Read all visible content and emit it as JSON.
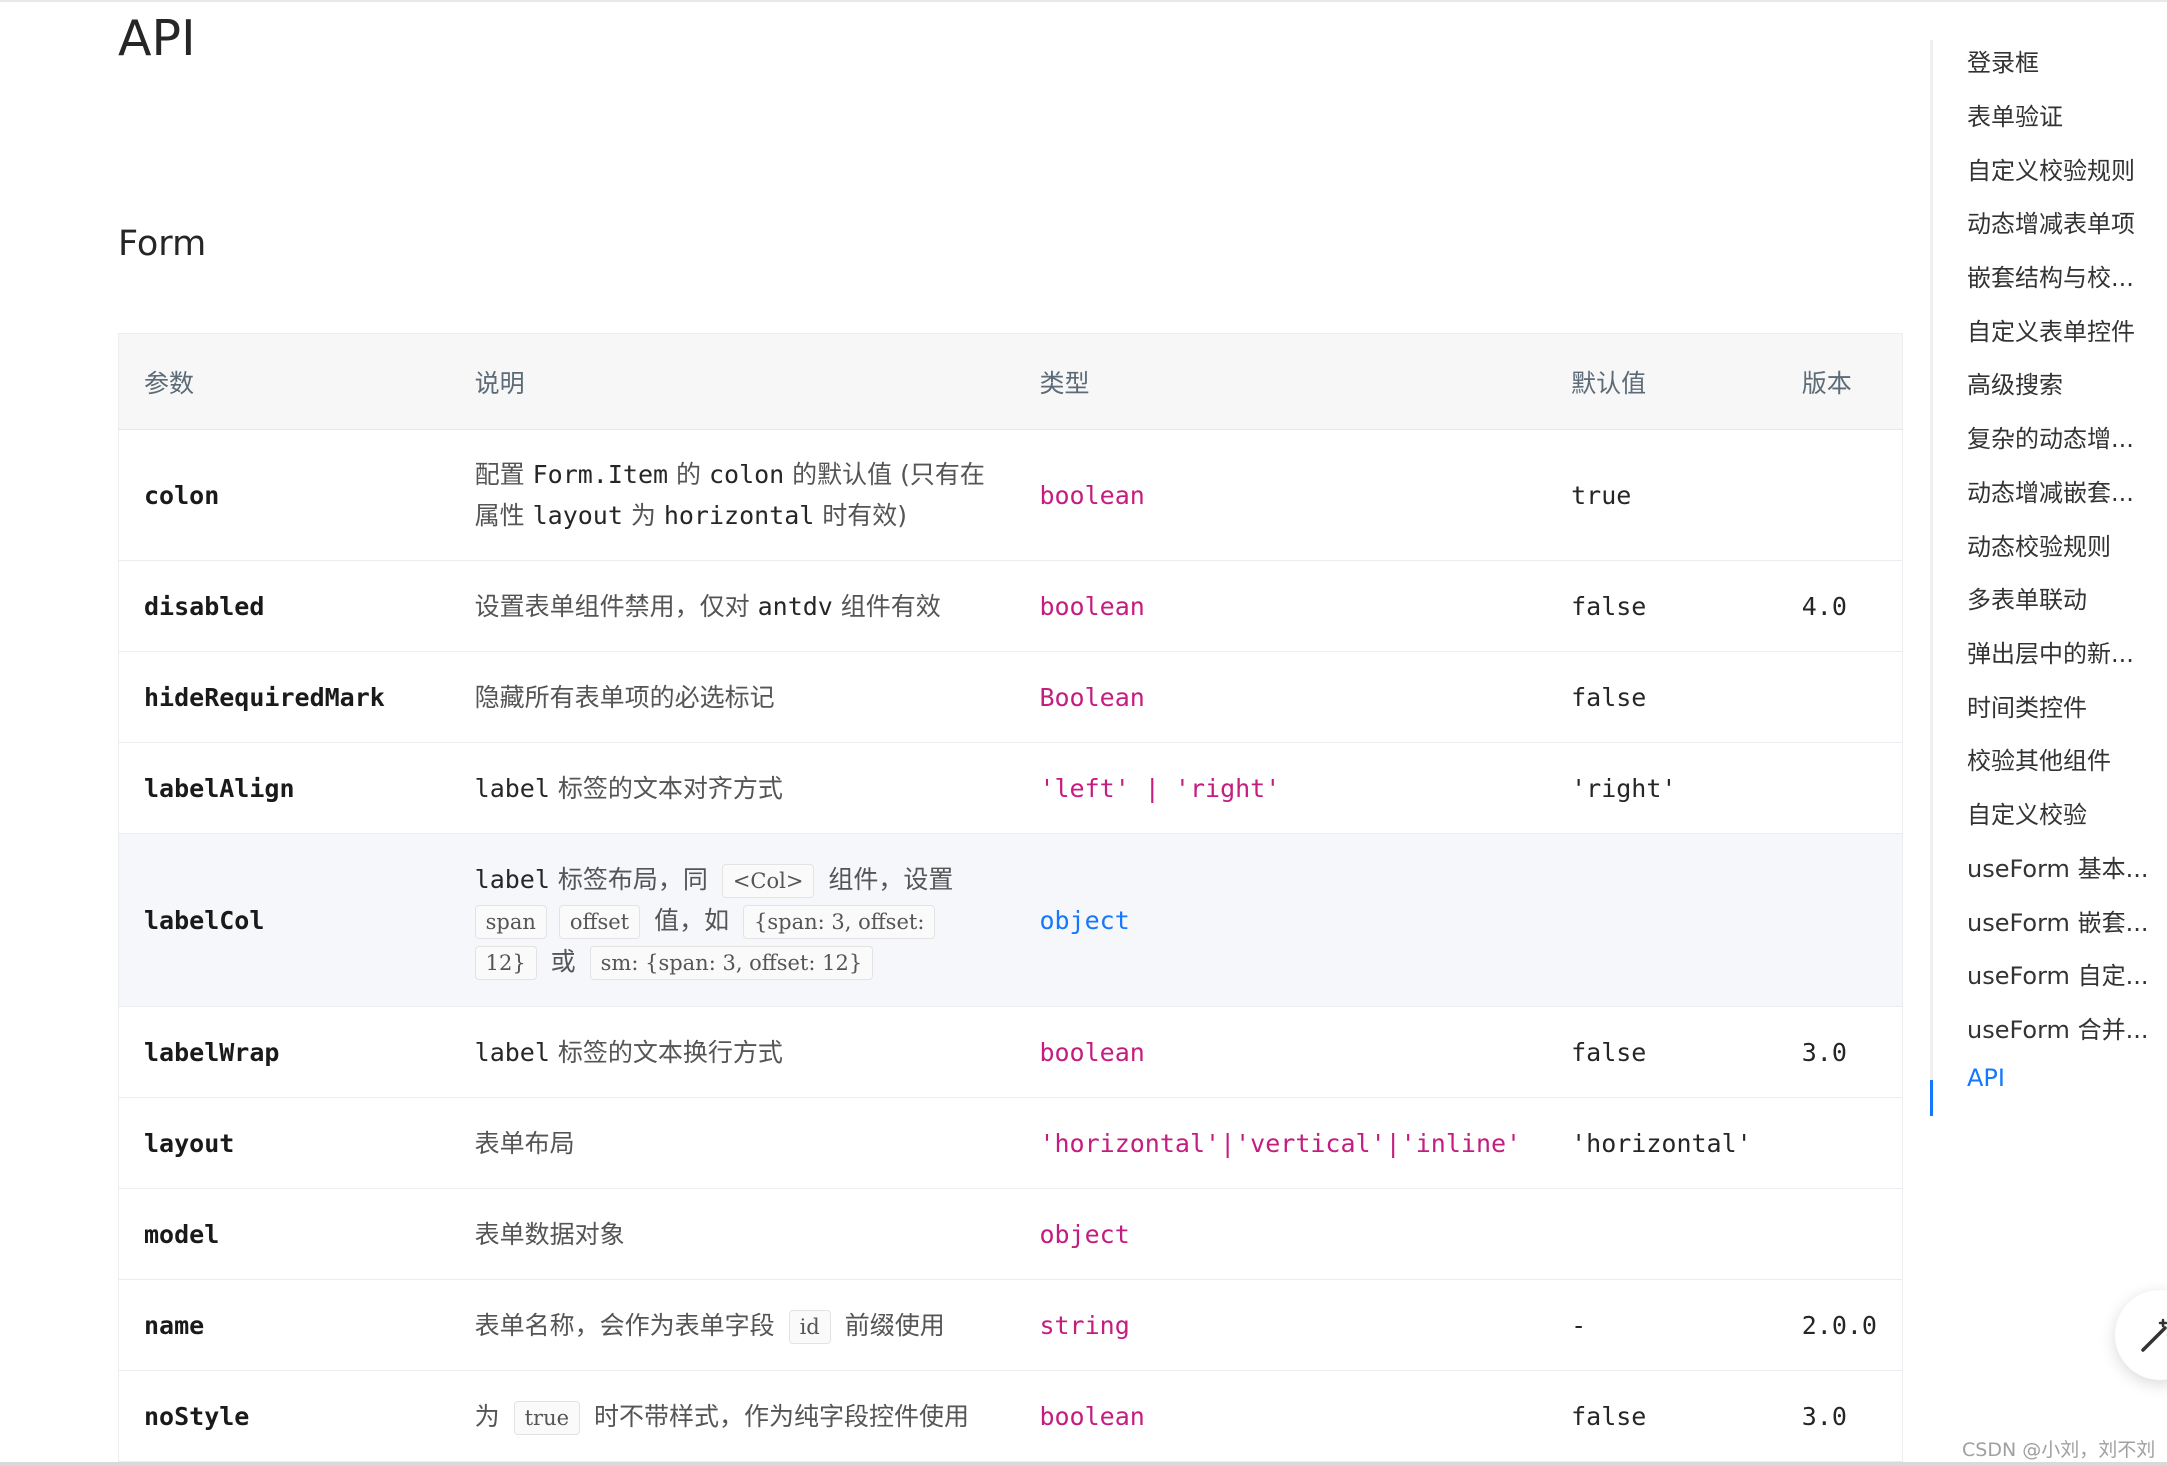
{
  "page": {
    "title": "API",
    "section": "Form"
  },
  "table": {
    "headers": [
      "参数",
      "说明",
      "类型",
      "默认值",
      "版本"
    ],
    "rows": [
      {
        "param": "colon",
        "desc_1": "配置 ",
        "desc_2": "Form.Item",
        "desc_3": " 的 ",
        "desc_4": "colon",
        "desc_5": " 的默认值 (只有在",
        "desc_6": "属性 ",
        "desc_7": "layout",
        "desc_8": " 为 ",
        "desc_9": "horizontal",
        "desc_10": " 时有效)",
        "type": "boolean",
        "default": "true",
        "version": ""
      },
      {
        "param": "disabled",
        "desc_1": "设置表单组件禁用，仅对 ",
        "desc_2": "antdv",
        "desc_3": " 组件有效",
        "type": "boolean",
        "default": "false",
        "version": "4.0"
      },
      {
        "param": "hideRequiredMark",
        "desc_1": "隐藏所有表单项的必选标记",
        "type": "Boolean",
        "default": "false",
        "version": ""
      },
      {
        "param": "labelAlign",
        "desc_1": "label",
        "desc_2": " 标签的文本对齐方式",
        "type": "'left' | 'right'",
        "default": "'right'",
        "version": ""
      },
      {
        "param": "labelCol",
        "desc_1": "label",
        "desc_2": " 标签布局，同 ",
        "tag_1": "<Col>",
        "desc_3": " 组件，设置",
        "tag_2": "span",
        "tag_3": "offset",
        "desc_4": " 值，如 ",
        "tag_4": "{span: 3, offset:",
        "tag_5": "12}",
        "desc_5": " 或 ",
        "tag_6": "sm: {span: 3, offset: 12}",
        "type": "object",
        "default": "",
        "version": ""
      },
      {
        "param": "labelWrap",
        "desc_1": "label",
        "desc_2": " 标签的文本换行方式",
        "type": "boolean",
        "default": "false",
        "version": "3.0"
      },
      {
        "param": "layout",
        "desc_1": "表单布局",
        "type": "'horizontal'|'vertical'|'inline'",
        "default": "'horizontal'",
        "version": ""
      },
      {
        "param": "model",
        "desc_1": "表单数据对象",
        "type": "object",
        "default": "",
        "version": ""
      },
      {
        "param": "name",
        "desc_1": "表单名称，会作为表单字段 ",
        "tag_1": "id",
        "desc_2": " 前缀使用",
        "type": "string",
        "default": "-",
        "version": "2.0.0"
      },
      {
        "param": "noStyle",
        "desc_1": "为 ",
        "tag_1": "true",
        "desc_2": " 时不带样式，作为纯字段控件使用",
        "type": "boolean",
        "default": "false",
        "version": "3.0"
      }
    ]
  },
  "toc": {
    "items": [
      "登录框",
      "表单验证",
      "自定义校验规则",
      "动态增减表单项",
      "嵌套结构与校...",
      "自定义表单控件",
      "高级搜索",
      "复杂的动态增...",
      "动态增减嵌套...",
      "动态校验规则",
      "多表单联动",
      "弹出层中的新...",
      "时间类控件",
      "校验其他组件",
      "自定义校验",
      "useForm 基本...",
      "useForm 嵌套...",
      "useForm 自定...",
      "useForm 合并...",
      "API"
    ],
    "active": "API"
  },
  "watermark": "CSDN @小刘，刘不刘",
  "colors": {
    "accent": "#1677ff",
    "type_pink": "#c41d7f",
    "header_bg": "#f7f7f7"
  },
  "icons": {
    "fab": "magic-wand-icon"
  }
}
